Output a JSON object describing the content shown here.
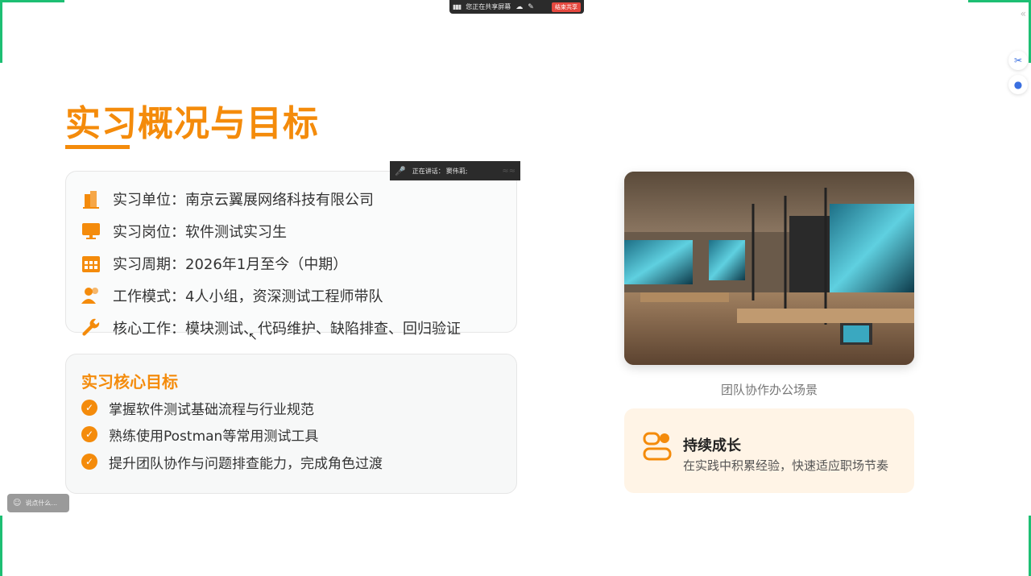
{
  "share_bar": {
    "status": "您正在共享屏幕",
    "stop_label": "结束共享"
  },
  "slide": {
    "title": "实习概况与目标",
    "info": [
      {
        "icon": "building-icon",
        "text": "实习单位：南京云翼展网络科技有限公司"
      },
      {
        "icon": "monitor-icon",
        "text": "实习岗位：软件测试实习生"
      },
      {
        "icon": "calendar-icon",
        "text": "实习周期：2026年1月至今（中期）"
      },
      {
        "icon": "people-icon",
        "text": "工作模式：4人小组，资深测试工程师带队"
      },
      {
        "icon": "wrench-icon",
        "text": "核心工作：模块测试、代码维护、缺陷排查、回归验证"
      }
    ],
    "goals_title": "实习核心目标",
    "goals": [
      "掌握软件测试基础流程与行业规范",
      "熟练使用Postman等常用测试工具",
      "提升团队协作与问题排查能力，完成角色过渡"
    ],
    "image_caption": "团队协作办公场景",
    "growth": {
      "title": "持续成长",
      "desc": "在实践中积累经验，快速适应职场节奏"
    }
  },
  "speaking": {
    "label": "正在讲话：",
    "name": "窦伟莉;"
  },
  "chat": {
    "placeholder": "说点什么..."
  },
  "colors": {
    "accent": "#f48b0b",
    "share_border": "#1dbf73",
    "stop_button": "#e5483f"
  }
}
